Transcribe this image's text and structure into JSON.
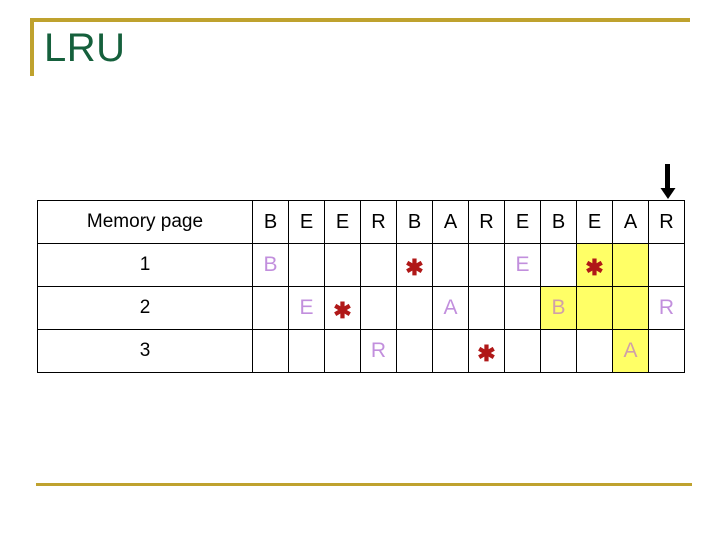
{
  "slide": {
    "title": "LRU",
    "title_color": "#15603c",
    "accent_color": "#bfa22e",
    "highlight_color": "#ffff66",
    "value_color": "#c28fdd",
    "star_color": "#b01818",
    "arrow": {
      "name": "down-arrow",
      "glyph": "↓"
    }
  },
  "table": {
    "label_header": "Memory page",
    "reference_string": [
      "B",
      "E",
      "E",
      "R",
      "B",
      "A",
      "R",
      "E",
      "B",
      "E",
      "A",
      "R"
    ],
    "rows": [
      {
        "label": "1",
        "cells": [
          "B",
          "",
          "",
          "",
          "*",
          "",
          "",
          "E",
          "",
          "*",
          "",
          ""
        ],
        "highlight": [
          false,
          false,
          false,
          false,
          false,
          false,
          false,
          false,
          false,
          true,
          true,
          false
        ]
      },
      {
        "label": "2",
        "cells": [
          "",
          "E",
          "*",
          "",
          "",
          "A",
          "",
          "",
          "B",
          "",
          "",
          "R"
        ],
        "highlight": [
          false,
          false,
          false,
          false,
          false,
          false,
          false,
          false,
          true,
          true,
          true,
          false
        ]
      },
      {
        "label": "3",
        "cells": [
          "",
          "",
          "",
          "R",
          "",
          "",
          "*",
          "",
          "",
          "",
          "A",
          ""
        ],
        "highlight": [
          false,
          false,
          false,
          false,
          false,
          false,
          false,
          false,
          false,
          false,
          true,
          false
        ]
      }
    ]
  }
}
